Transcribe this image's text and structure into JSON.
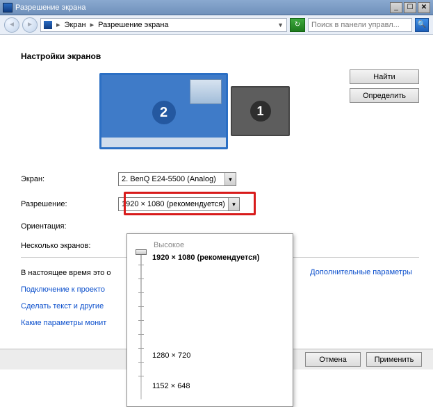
{
  "window": {
    "title": "Разрешение экрана"
  },
  "breadcrumb": {
    "item1": "Экран",
    "item2": "Разрешение экрана"
  },
  "search": {
    "placeholder": "Поиск в панели управл..."
  },
  "heading": "Настройки экранов",
  "monitors": {
    "num1": "1",
    "num2": "2"
  },
  "sideButtons": {
    "find": "Найти",
    "identify": "Определить"
  },
  "form": {
    "displayLabel": "Экран:",
    "displayValue": "2. BenQ E24-5500 (Analog)",
    "resolutionLabel": "Разрешение:",
    "resolutionValue": "1920 × 1080 (рекомендуется)",
    "orientationLabel": "Ориентация:",
    "multipleLabel": "Несколько экранов:"
  },
  "truncated": {
    "currentTime": "В настоящее время это о",
    "advancedLink": "Дополнительные параметры",
    "projectorLink": "Подключение к проекто",
    "textSizeLink": "Сделать текст и другие",
    "monitorParamsLink": "Какие параметры монит"
  },
  "resPopup": {
    "highLabel": "Высокое",
    "items": {
      "0": "1920 × 1080 (рекомендуется)",
      "1": "1280 × 720",
      "2": "1152 × 648"
    }
  },
  "footer": {
    "cancel": "Отмена",
    "apply": "Применить"
  }
}
